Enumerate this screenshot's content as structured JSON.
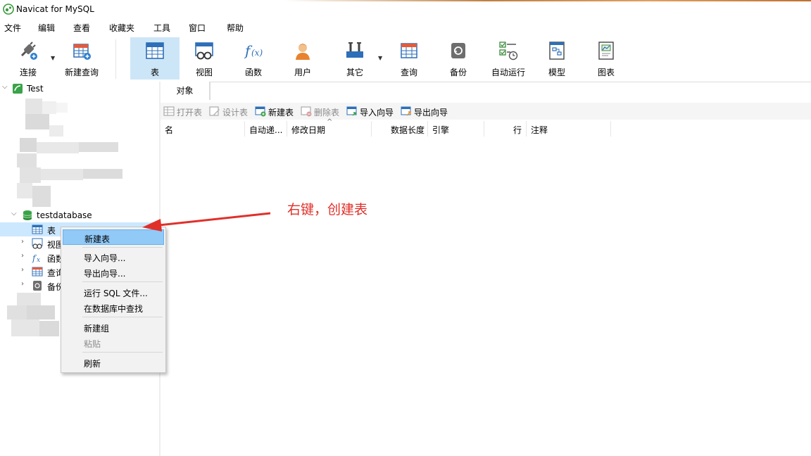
{
  "window": {
    "title": "Navicat for MySQL"
  },
  "menu": [
    "文件",
    "编辑",
    "查看",
    "收藏夹",
    "工具",
    "窗口",
    "帮助"
  ],
  "toolbar": {
    "buttons": [
      {
        "label": "连接",
        "icon": "plug-connect-icon"
      },
      {
        "label": "新建查询",
        "icon": "new-query-icon"
      },
      {
        "label": "表",
        "icon": "table-icon",
        "active": true
      },
      {
        "label": "视图",
        "icon": "view-icon"
      },
      {
        "label": "函数",
        "icon": "function-icon"
      },
      {
        "label": "用户",
        "icon": "user-icon"
      },
      {
        "label": "其它",
        "icon": "tools-icon"
      },
      {
        "label": "查询",
        "icon": "query-icon"
      },
      {
        "label": "备份",
        "icon": "backup-icon"
      },
      {
        "label": "自动运行",
        "icon": "schedule-icon"
      },
      {
        "label": "模型",
        "icon": "model-icon"
      },
      {
        "label": "图表",
        "icon": "chart-icon"
      }
    ]
  },
  "sidebar": {
    "connection": "Test",
    "database": "testdatabase",
    "items": [
      {
        "label": "表",
        "icon": "table-icon"
      },
      {
        "label": "视图",
        "icon": "view-icon"
      },
      {
        "label": "函数",
        "icon": "function-icon"
      },
      {
        "label": "查询",
        "icon": "query-icon"
      },
      {
        "label": "备份",
        "icon": "backup-icon"
      }
    ]
  },
  "tabs": {
    "objects": "对象"
  },
  "object_toolbar": {
    "open_table": "打开表",
    "design_table": "设计表",
    "new_table": "新建表",
    "delete_table": "删除表",
    "import_wizard": "导入向导",
    "export_wizard": "导出向导"
  },
  "columns": [
    "名",
    "自动递...",
    "修改日期",
    "数据长度",
    "引擎",
    "行",
    "注释"
  ],
  "context_menu": {
    "new_table": "新建表",
    "import_wizard": "导入向导...",
    "export_wizard": "导出向导...",
    "run_sql": "运行 SQL 文件...",
    "find_in_db": "在数据库中查找",
    "new_group": "新建组",
    "paste": "粘贴",
    "refresh": "刷新"
  },
  "annotation": {
    "text": "右键，创建表",
    "color": "#e0302a"
  },
  "colors": {
    "selection": "#cce8ff",
    "active_toolbar": "#cde6f7",
    "menu_highlight": "#91c9f7"
  }
}
